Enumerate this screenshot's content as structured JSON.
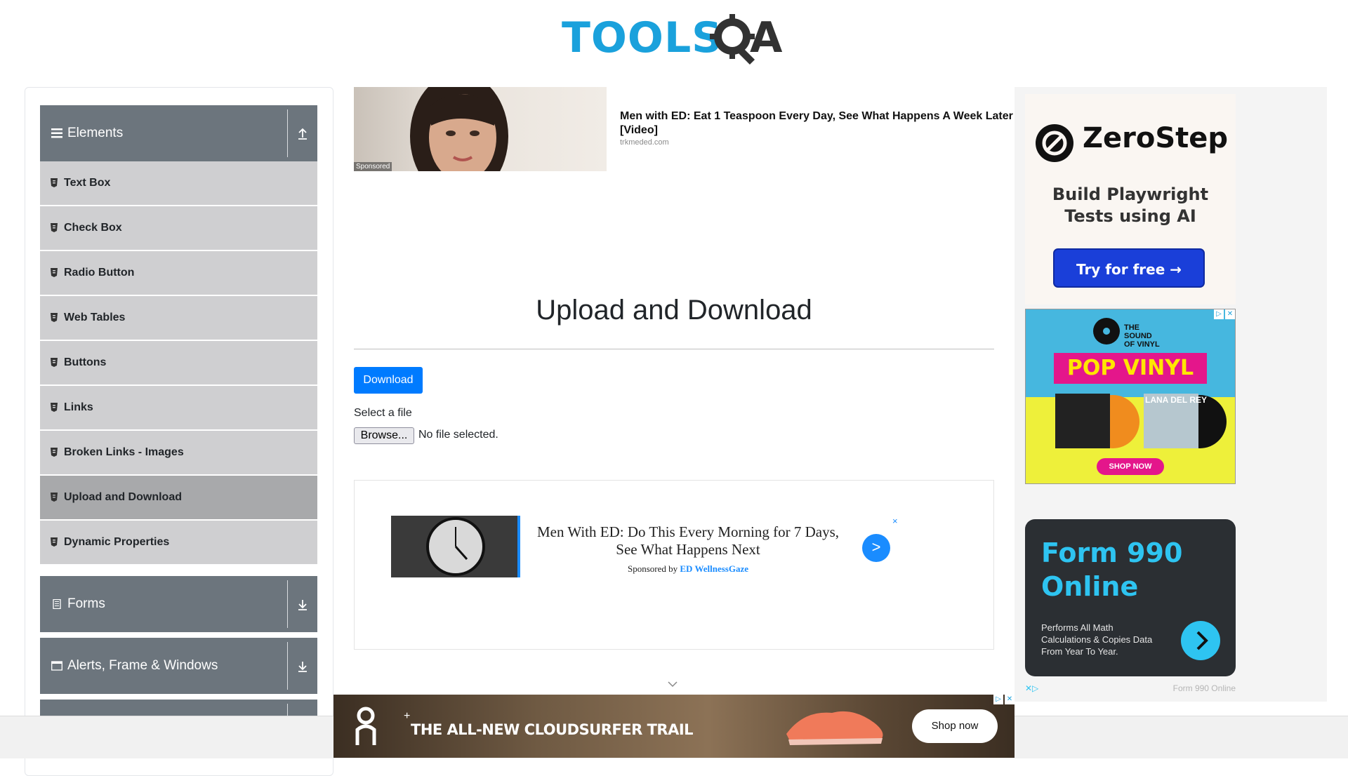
{
  "header": {
    "logo_text": "TOOLS",
    "logo_a": "A"
  },
  "sidebar": {
    "groups": [
      {
        "title": "Elements",
        "icon": "hamburger-icon",
        "arrow": "upload-arrow-icon"
      },
      {
        "title": "Forms",
        "icon": "document-icon",
        "arrow": "download-arrow-icon"
      },
      {
        "title": "Alerts, Frame & Windows",
        "icon": "window-icon",
        "arrow": "download-arrow-icon"
      }
    ],
    "items": [
      {
        "label": "Text Box"
      },
      {
        "label": "Check Box"
      },
      {
        "label": "Radio Button"
      },
      {
        "label": "Web Tables"
      },
      {
        "label": "Buttons"
      },
      {
        "label": "Links"
      },
      {
        "label": "Broken Links - Images"
      },
      {
        "label": "Upload and Download",
        "active": true
      },
      {
        "label": "Dynamic Properties"
      }
    ]
  },
  "top_ad": {
    "sponsored": "Sponsored",
    "headline": "Men with ED: Eat 1 Teaspoon Every Day, See What Happens A Week Later [Video]",
    "domain": "trkmeded.com"
  },
  "main": {
    "title": "Upload and Download",
    "download_label": "Download",
    "select_label": "Select a file",
    "browse_label": "Browse...",
    "file_status": "No file selected."
  },
  "mid_ad": {
    "headline": "Men With ED: Do This Every Morning for 7 Days, See What Happens Next",
    "sponsored_by": "Sponsored by",
    "brand": "ED WellnessGaze",
    "go": ">",
    "close": "×"
  },
  "right_ads": {
    "zerostep": {
      "name": "ZeroStep",
      "tagline": "Build Playwright Tests using AI",
      "cta": "Try for free →"
    },
    "vinyl": {
      "brand_line1": "THE SOUND",
      "brand_line2": "OF VINYL",
      "headline": "POP VINYL",
      "album_text": "LANA DEL REY",
      "cta": "SHOP NOW"
    },
    "form990": {
      "title_line1": "Form 990",
      "title_line2": "Online",
      "description": "Performs All Math Calculations & Copies Data From Year To Year.",
      "footer": "Form 990 Online"
    }
  },
  "bottom_ad": {
    "headline": "THE ALL-NEW CLOUDSURFER TRAIL",
    "cta": "Shop now"
  },
  "colors": {
    "accent": "#007bff",
    "sidebar_header": "#6c757d",
    "sidebar_item": "#cfcfd1",
    "sidebar_active": "#a8a9ab",
    "logo_blue": "#1aa1dc"
  }
}
